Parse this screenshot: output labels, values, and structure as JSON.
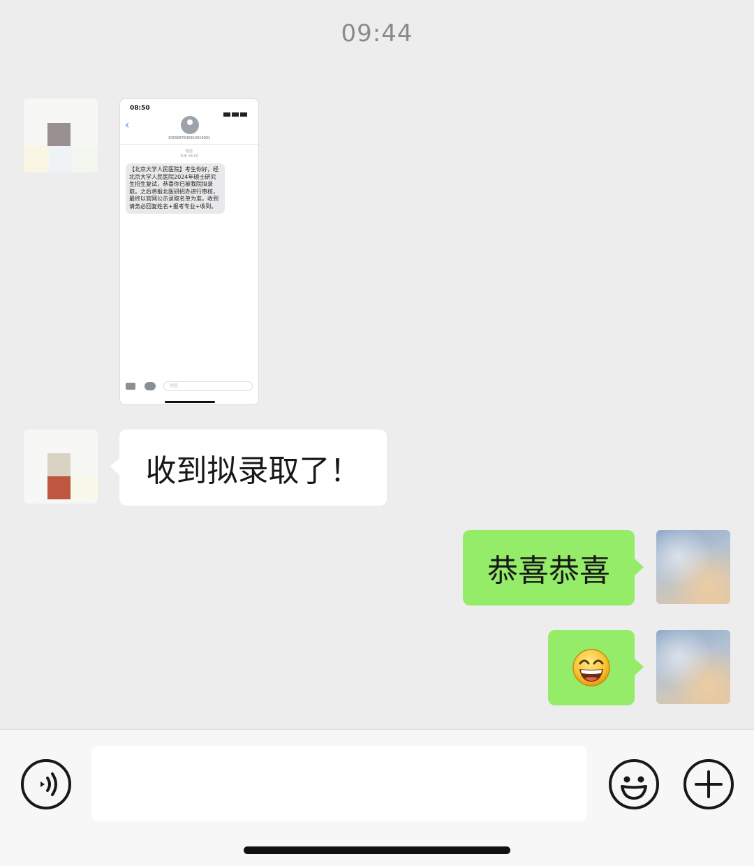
{
  "status": {
    "time": "09:44"
  },
  "messages": [
    {
      "side": "left",
      "kind": "image",
      "screenshot": {
        "status_time": "08:50",
        "sender_number": "1069087640910010001",
        "date_label": "短信",
        "date_time": "今天 08:50",
        "sms_text": "【北京大学人民医院】考生你好，经北京大学人民医院2024年硕士研究生招生复试，恭喜你已被我院拟录取。之后将报北医研招办进行审核，最终以官网公示录取名单为准。收到请务必回复姓名+报考专业+收到。",
        "input_placeholder": "短信"
      }
    },
    {
      "side": "left",
      "kind": "text",
      "text": "收到拟录取了！"
    },
    {
      "side": "right",
      "kind": "text",
      "text": "恭喜恭喜"
    },
    {
      "side": "right",
      "kind": "emoji",
      "emoji": "grinning-face-emoji"
    }
  ],
  "input_bar": {
    "voice_icon": "voice-icon",
    "emoji_icon": "smiley-icon",
    "plus_icon": "plus-icon",
    "text_value": ""
  },
  "colors": {
    "background": "#ededed",
    "sent_bubble": "#95ec69",
    "received_bubble": "#ffffff"
  }
}
